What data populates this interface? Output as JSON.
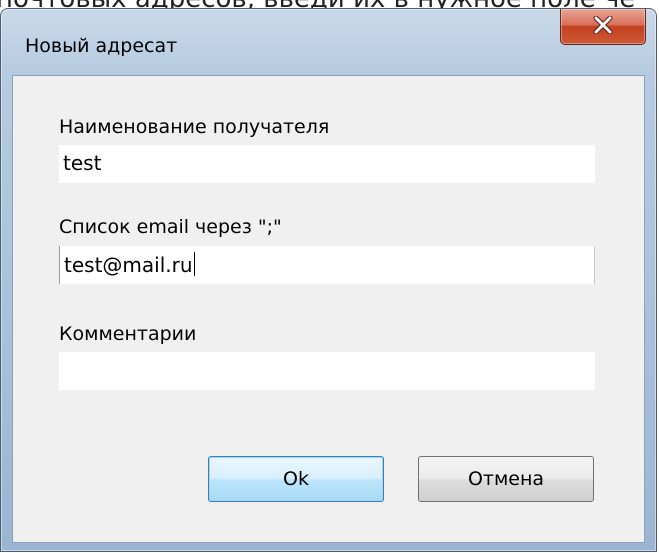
{
  "background": {
    "text": "почтовых адресов, введи их в нужное поле че"
  },
  "window": {
    "title": "Новый адресат",
    "close_icon": "close-icon"
  },
  "form": {
    "recipient_label": "Наименование получателя",
    "recipient_value": "test",
    "emails_label": "Список email через \";\"",
    "emails_value": "test@mail.ru",
    "comment_label": "Комментарии",
    "comment_value": ""
  },
  "buttons": {
    "ok_label": "Ok",
    "cancel_label": "Отмена"
  },
  "colors": {
    "close_button": "#c7452a",
    "frame": "#a8c0da",
    "dialog_bg": "#f0f0f0",
    "default_button": "#bee6fd"
  }
}
